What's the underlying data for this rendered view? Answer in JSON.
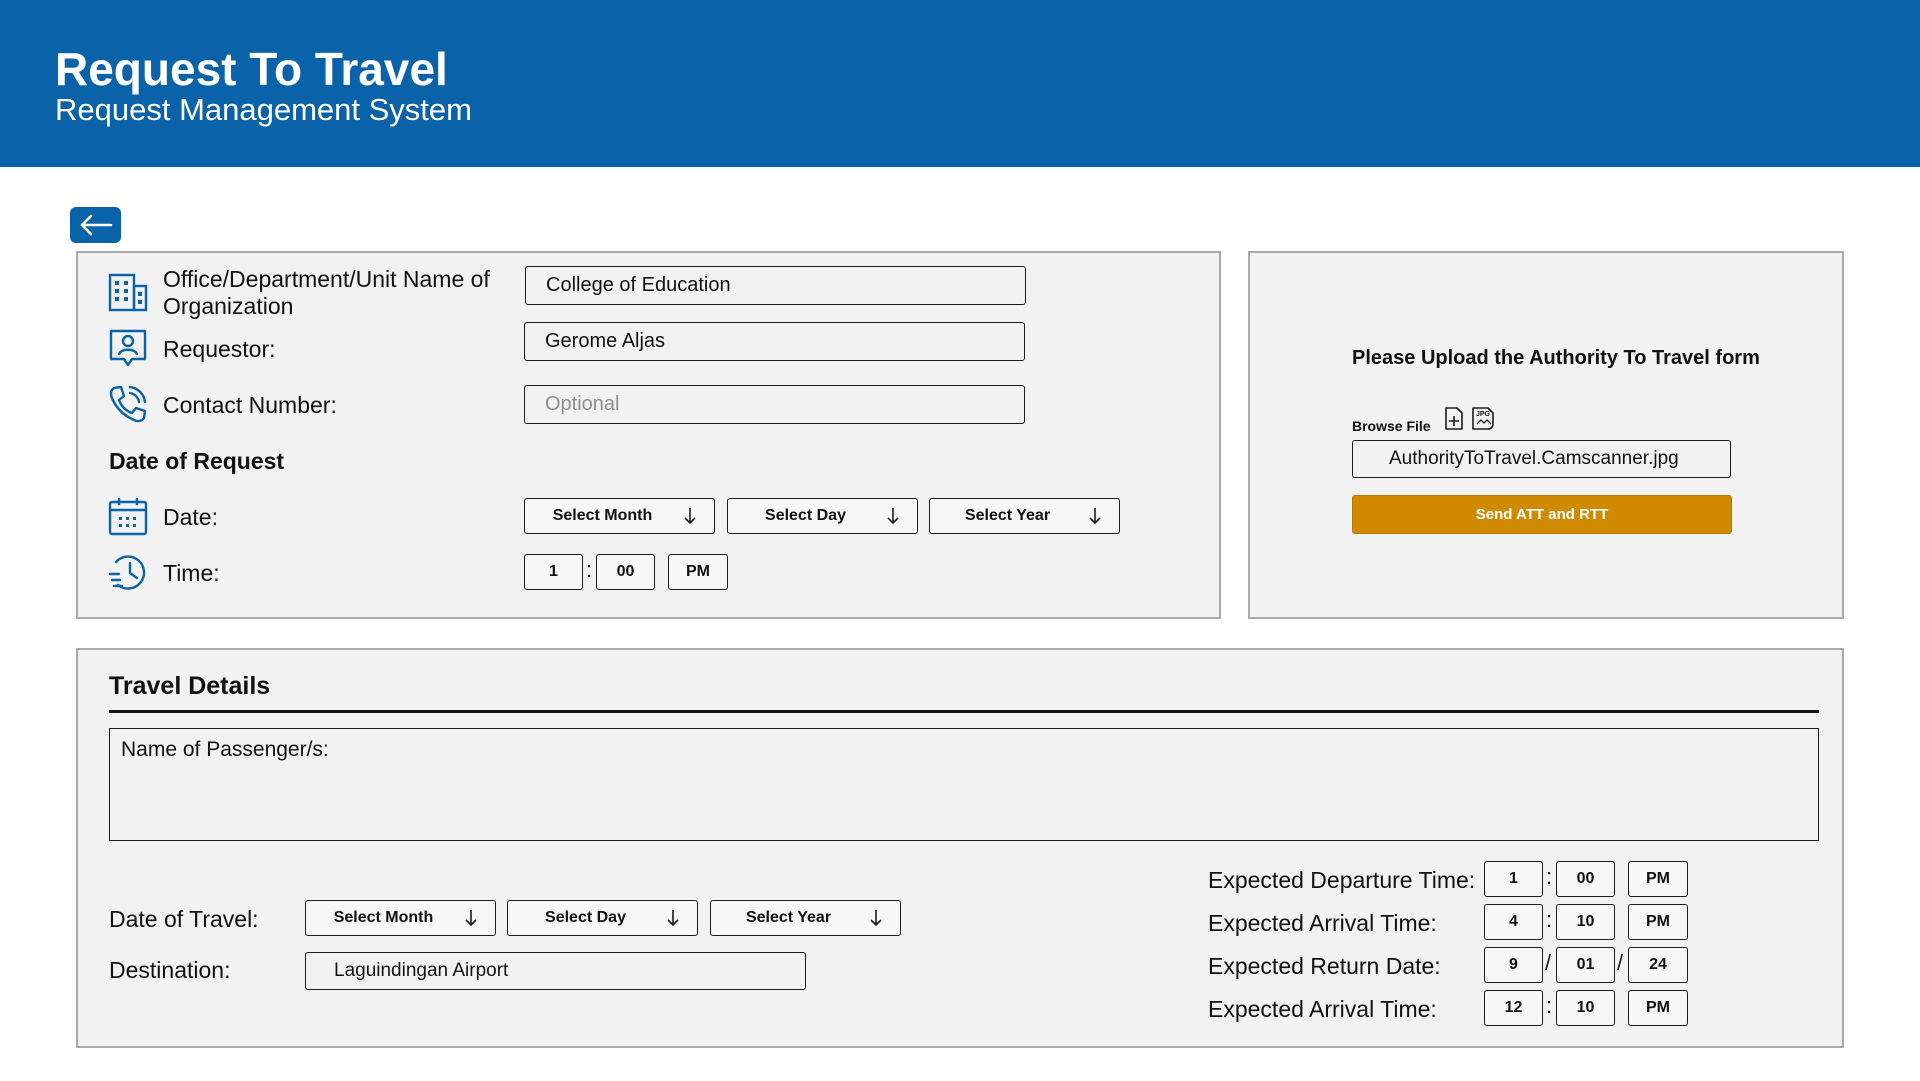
{
  "header": {
    "title": "Request To Travel",
    "subtitle": "Request Management System"
  },
  "colors": {
    "header_bg": "#0a62a8",
    "panel_bg": "#f2f2f2",
    "send_button": "#d08a00"
  },
  "request_form": {
    "office_label": "Office/Department/Unit Name of Organization",
    "office_label_line1": "Office/Department/Unit Name of",
    "office_label_line2": "Organization",
    "office_value": "College of Education",
    "requestor_label": "Requestor:",
    "requestor_value": "Gerome Aljas",
    "contact_label": "Contact Number:",
    "contact_placeholder": "Optional",
    "date_section_title": "Date of Request",
    "date_label": "Date:",
    "month_select": "Select Month",
    "day_select": "Select Day",
    "year_select": "Select Year",
    "time_label": "Time:",
    "time_hour": "1",
    "time_minute": "00",
    "time_period": "PM"
  },
  "upload": {
    "heading": "Please Upload the Authority To Travel form",
    "browse_label": "Browse File",
    "file_name": "AuthorityToTravel.Camscanner.jpg",
    "send_button": "Send ATT and RTT",
    "jpg_badge": "JPG"
  },
  "travel": {
    "title": "Travel Details",
    "passengers_label": "Name of Passenger/s:",
    "date_label": "Date of Travel:",
    "month_select": "Select Month",
    "day_select": "Select Day",
    "year_select": "Select Year",
    "destination_label": "Destination:",
    "destination_value": "Laguindingan Airport",
    "departure_label": "Expected Departure Time:",
    "departure_hour": "1",
    "departure_minute": "00",
    "departure_period": "PM",
    "arrival_label": "Expected Arrival Time:",
    "arrival_hour": "4",
    "arrival_minute": "10",
    "arrival_period": "PM",
    "return_label": "Expected Return Date:",
    "return_month": "9",
    "return_day": "01",
    "return_year": "24",
    "return_arrival_label": "Expected Arrival Time:",
    "return_arrival_hour": "12",
    "return_arrival_minute": "10",
    "return_arrival_period": "PM"
  }
}
